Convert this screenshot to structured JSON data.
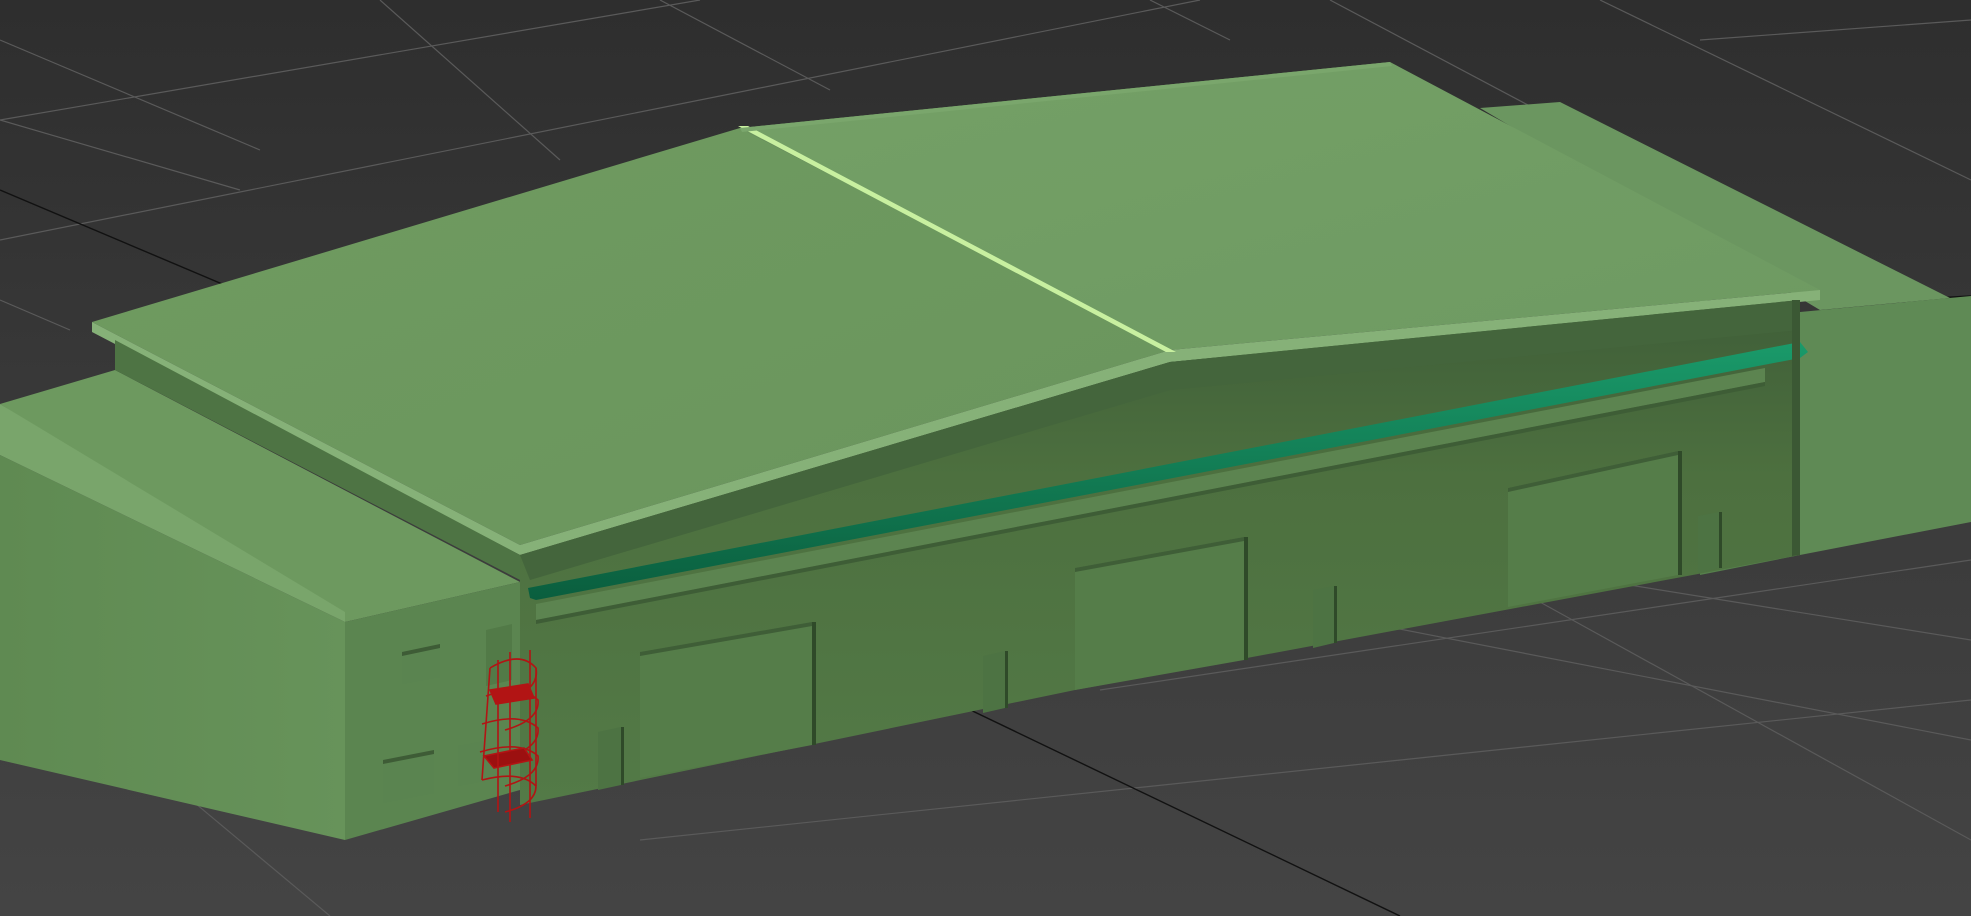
{
  "viewport": {
    "type": "3d-perspective-viewport",
    "background_color": "#3a3a3a",
    "grid_visible": true,
    "grid_line_color": "#5c5c5c",
    "axis_line_color": "#111111"
  },
  "scene": {
    "object": "hangar-building",
    "object_color": "#6f9964",
    "roof_color": "#70995f",
    "ridge_highlight_color": "#c8f0a0",
    "gutter_color": "#0f7a55",
    "stair_color": "#b21414",
    "components": [
      "main-roof",
      "front-facade",
      "left-annex",
      "right-annex",
      "gutter-strip",
      "hangar-doors",
      "personnel-doors",
      "windows",
      "spiral-staircase"
    ]
  }
}
